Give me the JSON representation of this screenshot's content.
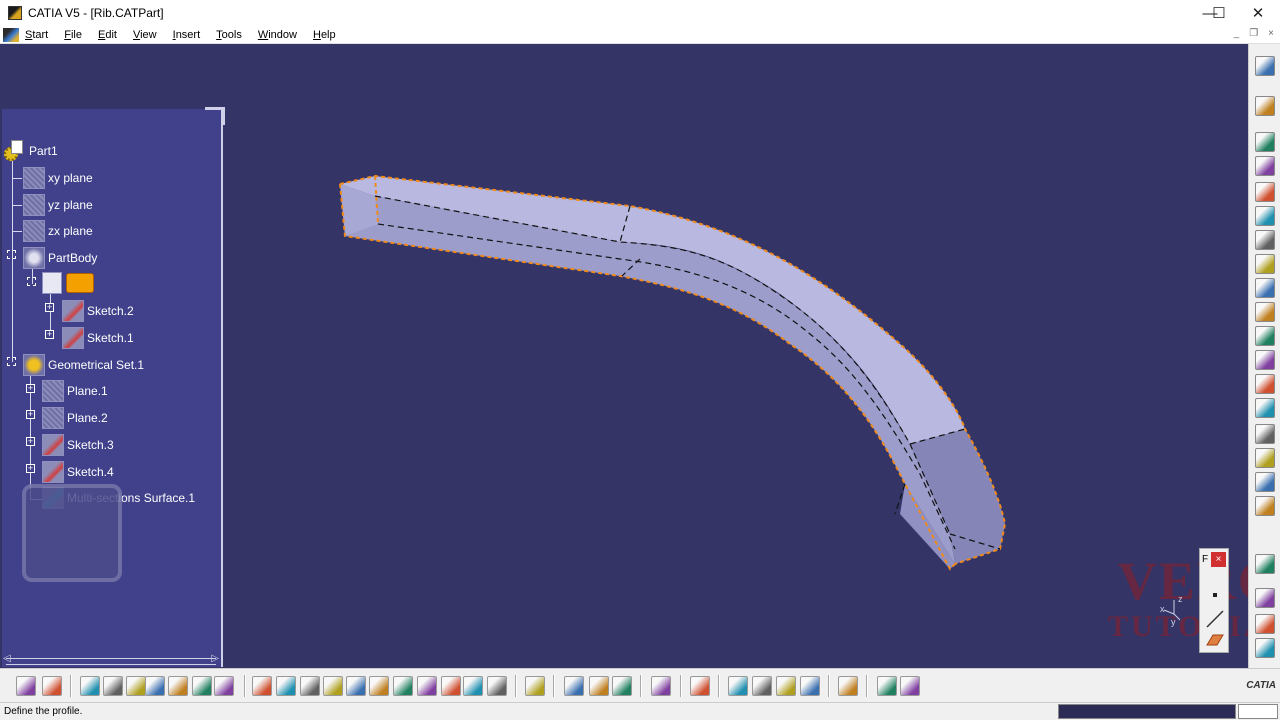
{
  "window": {
    "title": "CATIA V5 - [Rib.CATPart]",
    "minimize_glyph": "—",
    "maximize_glyph": "☐",
    "close_glyph": "✕"
  },
  "menu": {
    "items": [
      "Start",
      "File",
      "Edit",
      "View",
      "Insert",
      "Tools",
      "Window",
      "Help"
    ],
    "mdi_glyphs": [
      "_",
      "❐",
      "×"
    ]
  },
  "tree": {
    "root": "Part1",
    "planes": [
      "xy plane",
      "yz plane",
      "zx plane"
    ],
    "partbody": "PartBody",
    "rib_children": [
      "Sketch.2",
      "Sketch.1"
    ],
    "geoset": "Geometrical Set.1",
    "geoset_children": [
      "Plane.1",
      "Plane.2",
      "Sketch.3",
      "Sketch.4",
      "Multi-sections Surface.1"
    ]
  },
  "mini_toolbar": {
    "title": "F",
    "close": "×"
  },
  "axis": {
    "x": "x",
    "y": "y",
    "z": "z"
  },
  "watermark": {
    "line1": "VERO",
    "line2": "TUTORIAL"
  },
  "status": {
    "text": "Define the profile."
  },
  "brand": {
    "logo_text": "CATIA"
  },
  "colors": {
    "viewport_bg": "#343466",
    "tree_bg": "#40418a",
    "model_face": "#a9a9d6",
    "edge_highlight": "#f08a1c"
  },
  "right_toolbar_icons": [
    "sketcher-icon",
    "pad-icon",
    "pocket-icon",
    "shaft-icon",
    "groove-icon",
    "hole-icon",
    "rib-icon",
    "slot-icon",
    "stiffener-icon",
    "loft-icon",
    "remove-loft-icon",
    "multi-pad-icon",
    "plane-icon",
    "point-icon",
    "line-icon",
    "fillet-icon",
    "chamfer-icon",
    "draft-icon",
    "shell-icon",
    "thickness-icon",
    "thread-icon",
    "boolean-icon"
  ],
  "bottom_toolbar_icons": [
    "undo-icon",
    "redo-icon",
    "formula-icon",
    "knowledge-icon",
    "light-icon",
    "table-icon",
    "catalog-icon",
    "measure-icon",
    "analysis-icon",
    "fly-icon",
    "fit-all-icon",
    "pan-icon",
    "rotate-icon",
    "zoom-in-icon",
    "zoom-out-icon",
    "normal-view-icon",
    "iso-view-icon",
    "shading-icon",
    "hide-show-icon",
    "swap-space-icon",
    "tree-icon",
    "compass-icon",
    "parts-icon",
    "capture-icon",
    "constraint-icon",
    "material-icon",
    "apply-material-icon",
    "render-icon",
    "photo-icon",
    "texture-icon",
    "paint-icon",
    "check-icon",
    "update-icon"
  ]
}
